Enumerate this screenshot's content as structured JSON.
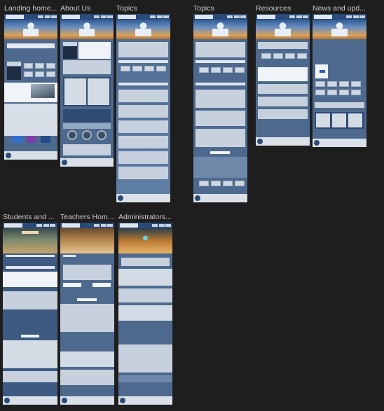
{
  "frames": [
    {
      "label": "Landing home..."
    },
    {
      "label": "About Us"
    },
    {
      "label": "Topics"
    },
    {
      "label": "Topics"
    },
    {
      "label": "Resources"
    },
    {
      "label": "News and upd..."
    },
    {
      "label": "Students and ..."
    },
    {
      "label": "Teachers Hom..."
    },
    {
      "label": "Administrators..."
    }
  ],
  "colors": {
    "canvas": "#1e1e1e",
    "page_background": "#4d6a8e",
    "nav": "#2a4a78",
    "panel": "#e2e7ee",
    "label_text": "#c9c9c9"
  }
}
